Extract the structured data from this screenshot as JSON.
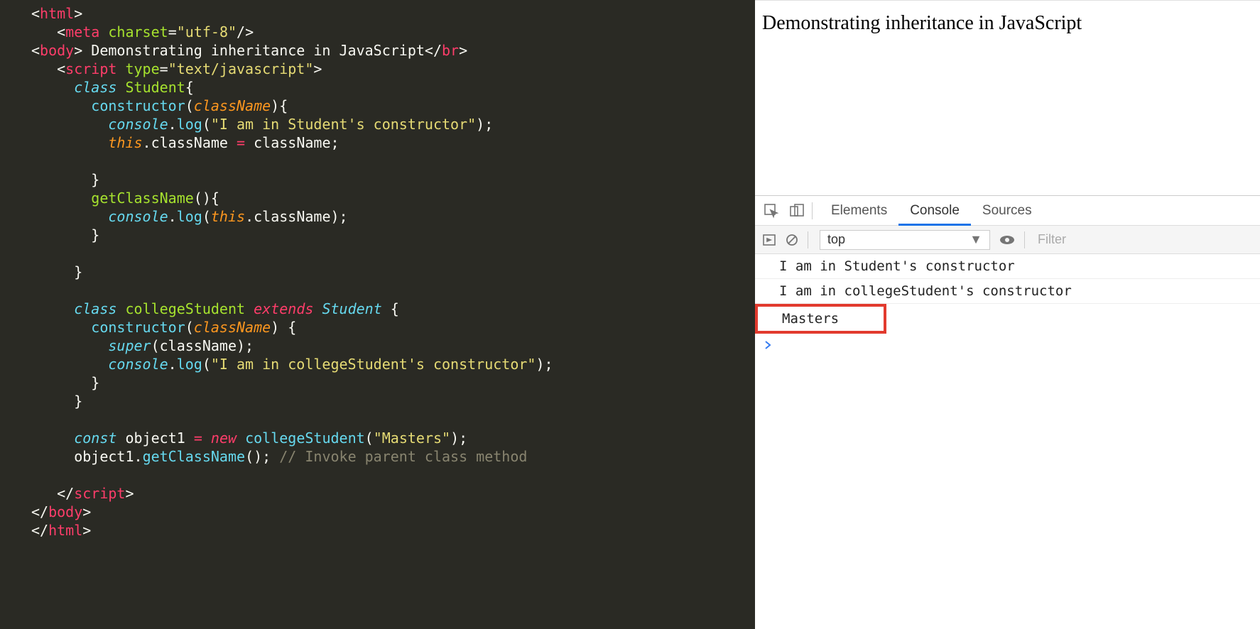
{
  "code": {
    "l1_tag": "html",
    "l2_tag": "meta",
    "l2_attr": "charset",
    "l2_val": "\"utf-8\"",
    "l3_tag": "body",
    "l3_text": " Demonstrating inheritance in JavaScript",
    "l3_br": "br",
    "l4_tag": "script",
    "l4_attr": "type",
    "l4_val": "\"text/javascript\"",
    "kw_class": "class",
    "cls_student": "Student",
    "kw_constructor": "constructor",
    "param_className": "className",
    "console": "console",
    "log": "log",
    "str_student_ctor": "\"I am in Student's constructor\"",
    "kw_this": "this",
    "prop_className": "className",
    "fn_getClassName": "getClassName",
    "cls_college": "collegeStudent",
    "kw_extends": "extends",
    "kw_super": "super",
    "str_college_ctor": "\"I am in collegeStudent's constructor\"",
    "kw_const": "const",
    "var_object1": "object1",
    "kw_new": "new",
    "str_masters": "\"Masters\"",
    "cmt_invoke": "// Invoke parent class method",
    "close_script": "script",
    "close_body": "body",
    "close_html": "html"
  },
  "page": {
    "text": "Demonstrating inheritance in JavaScript"
  },
  "devtools": {
    "tabs": {
      "elements": "Elements",
      "console": "Console",
      "sources": "Sources"
    },
    "context": "top",
    "filter_placeholder": "Filter",
    "messages": [
      "I am in Student's constructor",
      "I am in collegeStudent's constructor",
      "Masters"
    ]
  }
}
